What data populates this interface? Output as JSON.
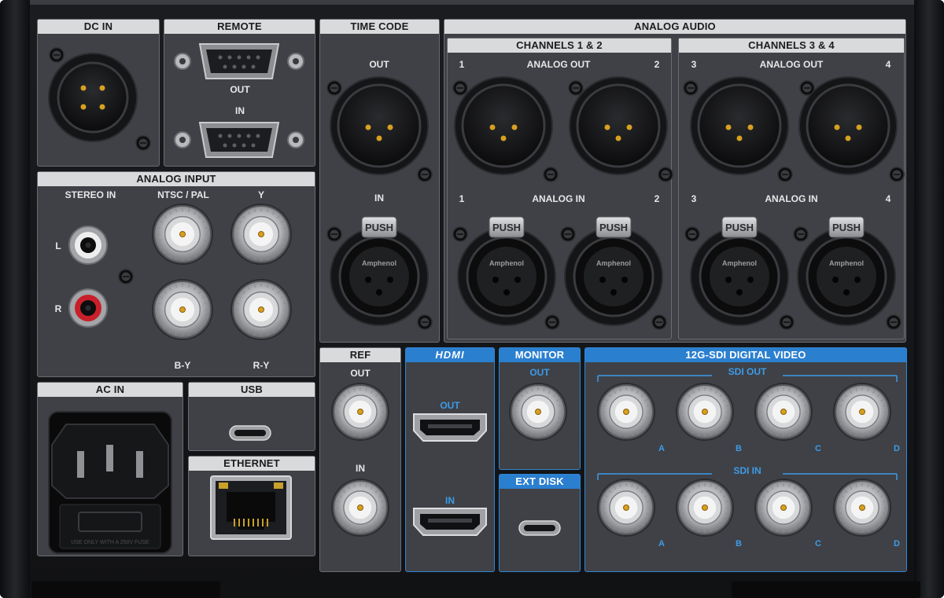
{
  "sections": {
    "dc_in": "DC IN",
    "remote": "REMOTE",
    "time_code": "TIME CODE",
    "analog_audio": "ANALOG AUDIO",
    "channels_12": "CHANNELS 1 & 2",
    "channels_34": "CHANNELS 3 & 4",
    "analog_input": "ANALOG INPUT",
    "ac_in": "AC IN",
    "usb": "USB",
    "ethernet": "ETHERNET",
    "ref": "REF",
    "hdmi": "HDMI",
    "monitor": "MONITOR",
    "ext_disk": "EXT DISK",
    "sdi": "12G-SDI DIGITAL VIDEO"
  },
  "labels": {
    "out": "OUT",
    "in": "IN",
    "analog_out": "ANALOG OUT",
    "analog_in": "ANALOG IN",
    "stereo_in": "STEREO IN",
    "ntsc_pal": "NTSC / PAL",
    "y": "Y",
    "l": "L",
    "r": "R",
    "by": "B-Y",
    "ry": "R-Y",
    "sdi_out": "SDI OUT",
    "sdi_in": "SDI IN",
    "a": "A",
    "b": "B",
    "c": "C",
    "d": "D",
    "ch1": "1",
    "ch2": "2",
    "ch3": "3",
    "ch4": "4",
    "push": "PUSH",
    "amphenol": "Amphenol",
    "fuse_text": "USE ONLY WITH A 250V FUSE"
  },
  "colors": {
    "panel": "#3f4146",
    "header": "#d9dadb",
    "accent_blue": "#2b7fcf",
    "rca_red": "#c8202a"
  }
}
